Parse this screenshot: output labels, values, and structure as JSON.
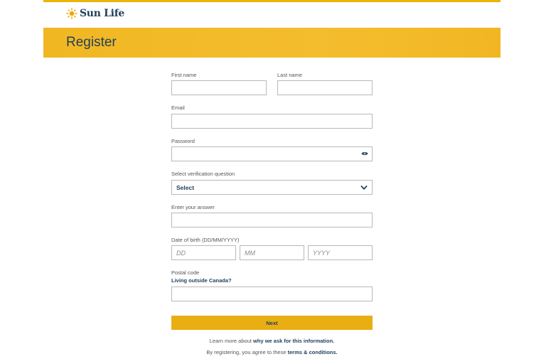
{
  "brand": {
    "name": "Sun Life"
  },
  "page": {
    "title": "Register"
  },
  "form": {
    "first_name": {
      "label": "First name",
      "value": ""
    },
    "last_name": {
      "label": "Last name",
      "value": ""
    },
    "email": {
      "label": "Email",
      "value": ""
    },
    "password": {
      "label": "Password",
      "value": "",
      "toggle_icon": "eye-icon"
    },
    "verification_question": {
      "label": "Select verification question",
      "selected": "Select",
      "icon": "chevron-down-icon"
    },
    "answer": {
      "label": "Enter your answer",
      "value": ""
    },
    "dob": {
      "label": "Date of birth (DD/MM/YYYY)",
      "day_placeholder": "DD",
      "month_placeholder": "MM",
      "year_placeholder": "YYYY"
    },
    "postal_code": {
      "label": "Postal code",
      "outside_link": "Living outside Canada?",
      "value": ""
    },
    "next_label": "Next"
  },
  "footer": {
    "learn_prefix": "Learn more about ",
    "learn_link": "why we ask for this information.",
    "terms_prefix": "By registering, you agree to these ",
    "terms_link": "terms & conditions."
  },
  "colors": {
    "accent": "#F2B623",
    "button": "#E9AE13",
    "navy": "#1F3F5B"
  }
}
